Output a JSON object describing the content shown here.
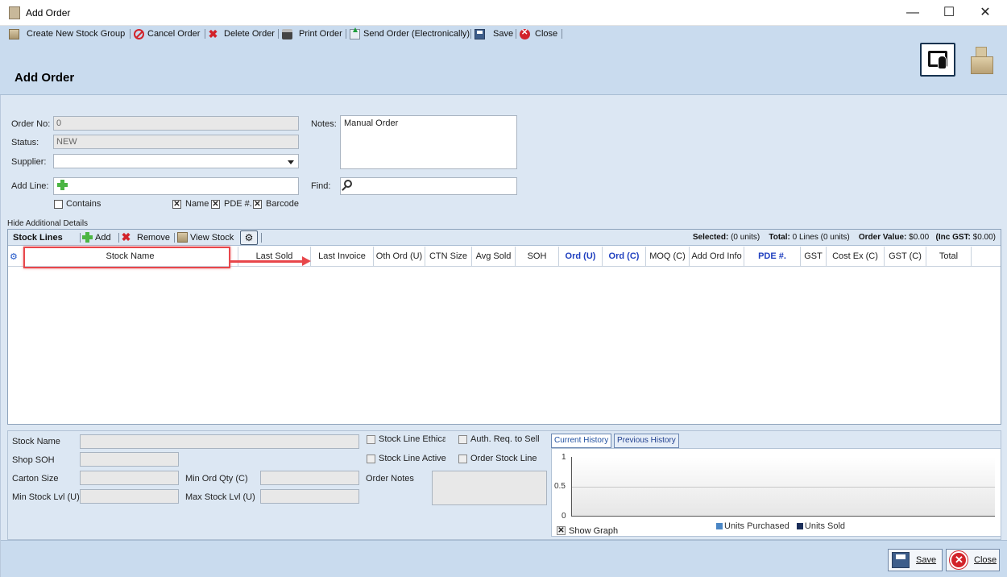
{
  "window": {
    "title": "Add Order",
    "minimize": "—",
    "maximize": "☐",
    "close": "✕"
  },
  "toolbar": {
    "create_group": "Create New Stock Group",
    "cancel_order": "Cancel Order",
    "delete_order": "Delete Order",
    "print_order": "Print Order",
    "send_order": "Send Order (Electronically)",
    "save": "Save",
    "close": "Close"
  },
  "header": {
    "title": "Add Order"
  },
  "form": {
    "order_no_label": "Order No:",
    "order_no_value": "0",
    "status_label": "Status:",
    "status_value": "NEW",
    "supplier_label": "Supplier:",
    "supplier_value": "",
    "add_line_label": "Add Line:",
    "notes_label": "Notes:",
    "notes_value": "Manual Order",
    "find_label": "Find:",
    "contains_label": "Contains",
    "name_label": "Name",
    "pde_label": "PDE #.",
    "barcode_label": "Barcode",
    "hide_details": "Hide Additional Details",
    "contains_checked": false,
    "name_checked": true,
    "pde_checked": true,
    "barcode_checked": true
  },
  "grid": {
    "title": "Stock Lines",
    "add": "Add",
    "remove": "Remove",
    "view_stock": "View Stock",
    "gear": "⚙",
    "selected_label": "Selected:",
    "selected_value": "(0 units)",
    "total_label": "Total:",
    "total_value": "0 Lines (0 units)",
    "order_value_label": "Order Value:",
    "order_value_value": "$0.00",
    "inc_gst_label": "(Inc GST:",
    "inc_gst_value": "$0.00)",
    "columns": [
      "Stock Name",
      "Last Sold",
      "Last Invoice",
      "Oth Ord (U)",
      "CTN Size",
      "Avg Sold",
      "SOH",
      "Ord (U)",
      "Ord (C)",
      "MOQ (C)",
      "Add Ord Info",
      "PDE #.",
      "GST",
      "Cost Ex (C)",
      "GST (C)",
      "Total"
    ],
    "col_gear": "⚙"
  },
  "details": {
    "stock_name_label": "Stock Name",
    "shop_soh_label": "Shop SOH",
    "carton_size_label": "Carton Size",
    "min_stock_label": "Min Stock Lvl (U)",
    "min_ord_qty_label": "Min Ord Qty (C)",
    "max_stock_label": "Max Stock Lvl (U)",
    "stock_line_ethical": "Stock Line Ethical",
    "auth_req": "Auth. Req. to Sell",
    "stock_line_active": "Stock Line Active",
    "order_stock_line": "Order Stock Line",
    "order_notes_label": "Order Notes"
  },
  "history": {
    "tab_current": "Current History",
    "tab_previous": "Previous History",
    "y_ticks": [
      "1",
      "0.5",
      "0"
    ],
    "legend_purchased": "Units Purchased",
    "legend_sold": "Units Sold",
    "show_graph": "Show Graph",
    "purchased_color": "#4a86c5",
    "sold_color": "#1b2e59"
  },
  "bottom": {
    "save": "Save",
    "close": "Close"
  }
}
